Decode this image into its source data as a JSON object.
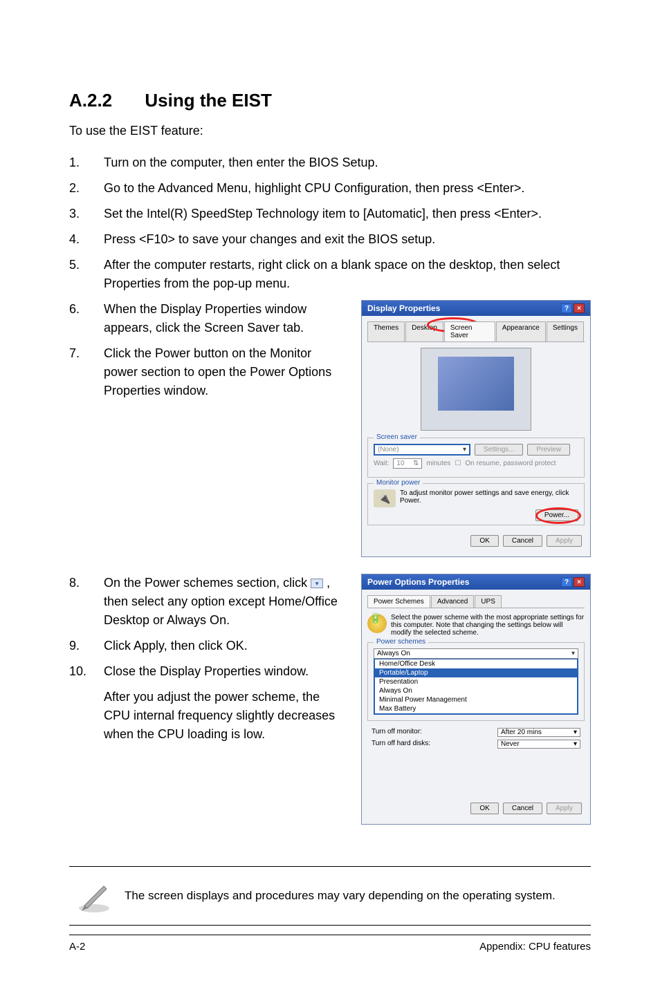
{
  "heading": {
    "number": "A.2.2",
    "title": "Using the EIST"
  },
  "intro": "To use the EIST feature:",
  "steps_a": [
    {
      "n": "1.",
      "t": "Turn on the computer, then enter the BIOS Setup."
    },
    {
      "n": "2.",
      "t": "Go to the Advanced Menu, highlight CPU Configuration, then press <Enter>."
    },
    {
      "n": "3.",
      "t": "Set the Intel(R) SpeedStep Technology item to [Automatic], then press <Enter>."
    },
    {
      "n": "4.",
      "t": "Press <F10> to save your changes and exit the BIOS setup."
    },
    {
      "n": "5.",
      "t": "After the computer restarts, right click on a blank space on the desktop, then select Properties from the pop-up menu."
    }
  ],
  "steps_b": [
    {
      "n": "6.",
      "t": "When the Display Properties window appears, click the Screen Saver tab."
    },
    {
      "n": "7.",
      "t": "Click the Power button on the Monitor power section to open the Power Options Properties window."
    }
  ],
  "steps_c": [
    {
      "n": "8.",
      "t_pre": "On the Power schemes section, click ",
      "t_post": ", then select any option except Home/Office Desktop or Always On."
    },
    {
      "n": "9.",
      "t": "Click Apply, then click OK."
    },
    {
      "n": "10.",
      "t": "Close the Display Properties window."
    }
  ],
  "after_text": "After you adjust the power scheme, the CPU internal frequency slightly decreases when the CPU loading is low.",
  "dialog1": {
    "title": "Display Properties",
    "tabs": [
      "Themes",
      "Desktop",
      "Screen Saver",
      "Appearance",
      "Settings"
    ],
    "active_tab": "Screen Saver",
    "ss_label": "Screen saver",
    "ss_value": "(None)",
    "settings_btn": "Settings...",
    "preview_btn": "Preview",
    "wait_label": "Wait:",
    "wait_value": "10",
    "wait_unit": "minutes",
    "resume_label": "On resume, password protect",
    "mp_label": "Monitor power",
    "mp_text": "To adjust monitor power settings and save energy, click Power.",
    "power_btn": "Power...",
    "ok": "OK",
    "cancel": "Cancel",
    "apply": "Apply"
  },
  "dialog2": {
    "title": "Power Options Properties",
    "tabs": [
      "Power Schemes",
      "Advanced",
      "UPS"
    ],
    "active_tab": "Power Schemes",
    "descr": "Select the power scheme with the most appropriate settings for this computer. Note that changing the settings below will modify the selected scheme.",
    "ps_label": "Power schemes",
    "ps_value": "Always On",
    "options": [
      "Home/Office Desk",
      "Portable/Laptop",
      "Presentation",
      "Always On",
      "Minimal Power Management",
      "Max Battery"
    ],
    "selected_option": "Portable/Laptop",
    "mon_label": "Turn off monitor:",
    "mon_value": "After 20 mins",
    "hd_label": "Turn off hard disks:",
    "hd_value": "Never",
    "ok": "OK",
    "cancel": "Cancel",
    "apply": "Apply"
  },
  "note": "The screen displays and procedures may vary depending on the operating system.",
  "footer": {
    "left": "A-2",
    "right": "Appendix: CPU features"
  }
}
